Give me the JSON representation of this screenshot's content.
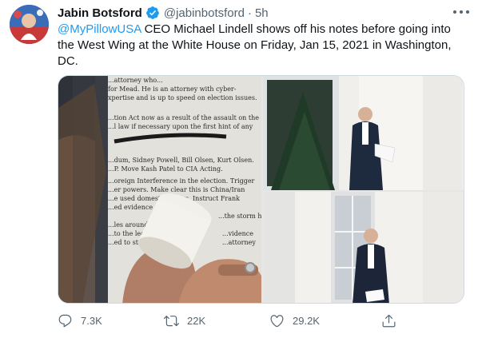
{
  "tweet": {
    "author": {
      "name": "Jabin Botsford",
      "handle": "@jabinbotsford",
      "verified": true,
      "avatar_icon": "profile-photo"
    },
    "separator": "·",
    "time": "5h",
    "text": {
      "mention": "@MyPillowUSA",
      "body": " CEO Michael Lindell shows off his notes before going into the West Wing at the White House on Friday, Jan 15, 2021 in Washington, DC."
    },
    "media": {
      "count": 3,
      "photo_left": {
        "note_lines": [
          "...attorney who...",
          "for Mead. He is an attorney with cyber-",
          "xpertise and is up to speed on election issues.",
          "...tion Act now as a result of the assault on the",
          "...l law if necessary upon the first hint of any",
          "...dum, Sidney Powell, Bill Olsen, Kurt Olsen.",
          "...P. Move Kash Patel to CIA Acting.",
          "...oreign Interference in the election. Trigger",
          "...er powers. Make clear this is China/Iran",
          "...e used domestic actors. Instruct Frank",
          "...ed evidence on",
          "...the storm head",
          "...les around",
          "...to the lead",
          "...ed to start",
          "...vidence",
          "...attorney"
        ]
      }
    },
    "actions": {
      "reply": {
        "icon": "reply-icon",
        "count": "7.3K"
      },
      "retweet": {
        "icon": "retweet-icon",
        "count": "22K"
      },
      "like": {
        "icon": "heart-icon",
        "count": "29.2K"
      },
      "share": {
        "icon": "share-icon"
      }
    },
    "colors": {
      "link": "#1d9bf0",
      "verified": "#1d9bf0",
      "secondary_text": "#536471",
      "border": "#cfd9de"
    }
  }
}
